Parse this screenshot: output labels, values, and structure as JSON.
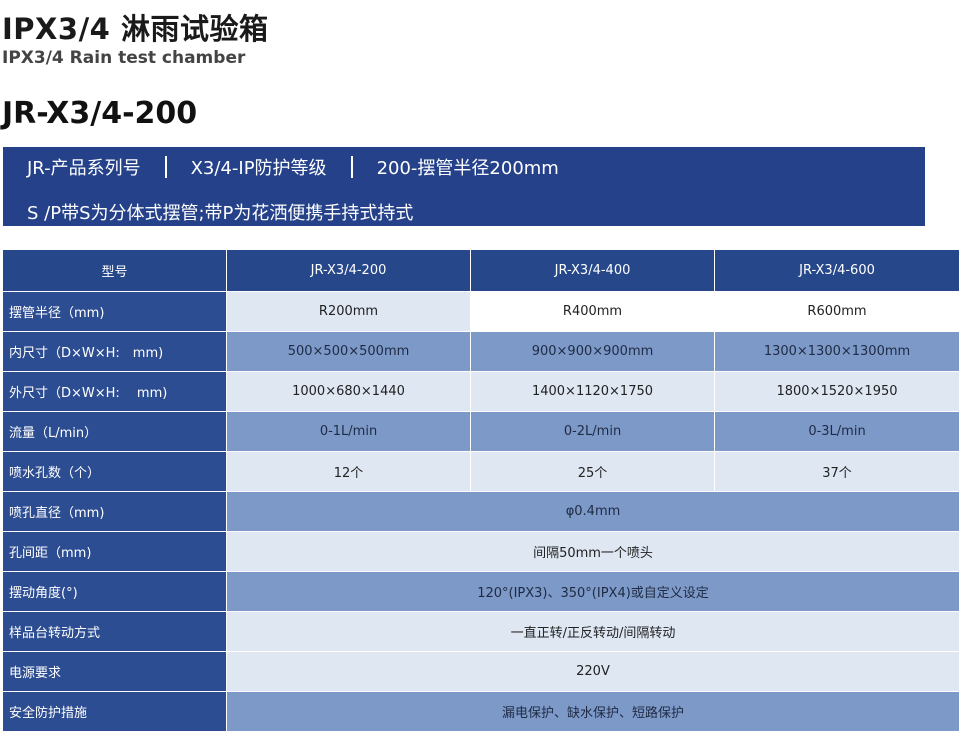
{
  "header": {
    "title_cn": "IPX3/4 淋雨试验箱",
    "title_en": "IPX3/4 Rain test chamber",
    "model": "JR-X3/4-200"
  },
  "banner": {
    "item1": "JR-产品系列号",
    "item2": "X3/4-IP防护等级",
    "item3": "200-摆管半径200mm",
    "line2": "S /P带S为分体式摆管;带P为花洒便携手持式持式"
  },
  "table": {
    "headers": [
      "型号",
      "JR-X3/4-200",
      "JR-X3/4-400",
      "JR-X3/4-600"
    ],
    "rows": [
      {
        "label": "摆管半径（mm)",
        "values": [
          "R200mm",
          "R400mm",
          "R600mm"
        ]
      },
      {
        "label": "内尺寸（D×W×H:　mm)",
        "values": [
          "500×500×500mm",
          "900×900×900mm",
          "1300×1300×1300mm"
        ]
      },
      {
        "label": "外尺寸（D×W×H:　 mm)",
        "values": [
          "1000×680×1440",
          "1400×1120×1750",
          "1800×1520×1950"
        ]
      },
      {
        "label": "流量（L/min）",
        "values": [
          "0-1L/min",
          "0-2L/min",
          "0-3L/min"
        ]
      },
      {
        "label": "喷水孔数（个）",
        "values": [
          "12个",
          "25个",
          "37个"
        ]
      },
      {
        "label": "喷孔直径（mm)",
        "value": "φ0.4mm"
      },
      {
        "label": "孔间距（mm)",
        "value": "间隔50mm一个喷头"
      },
      {
        "label": "摆动角度(°)",
        "value": "120°(IPX3)、350°(IPX4)或自定义设定"
      },
      {
        "label": "样品台转动方式",
        "value": "一直正转/正反转动/间隔转动"
      },
      {
        "label": "电源要求",
        "value": "220V"
      },
      {
        "label": "安全防护措施",
        "value": "漏电保护、缺水保护、短路保护"
      }
    ]
  }
}
